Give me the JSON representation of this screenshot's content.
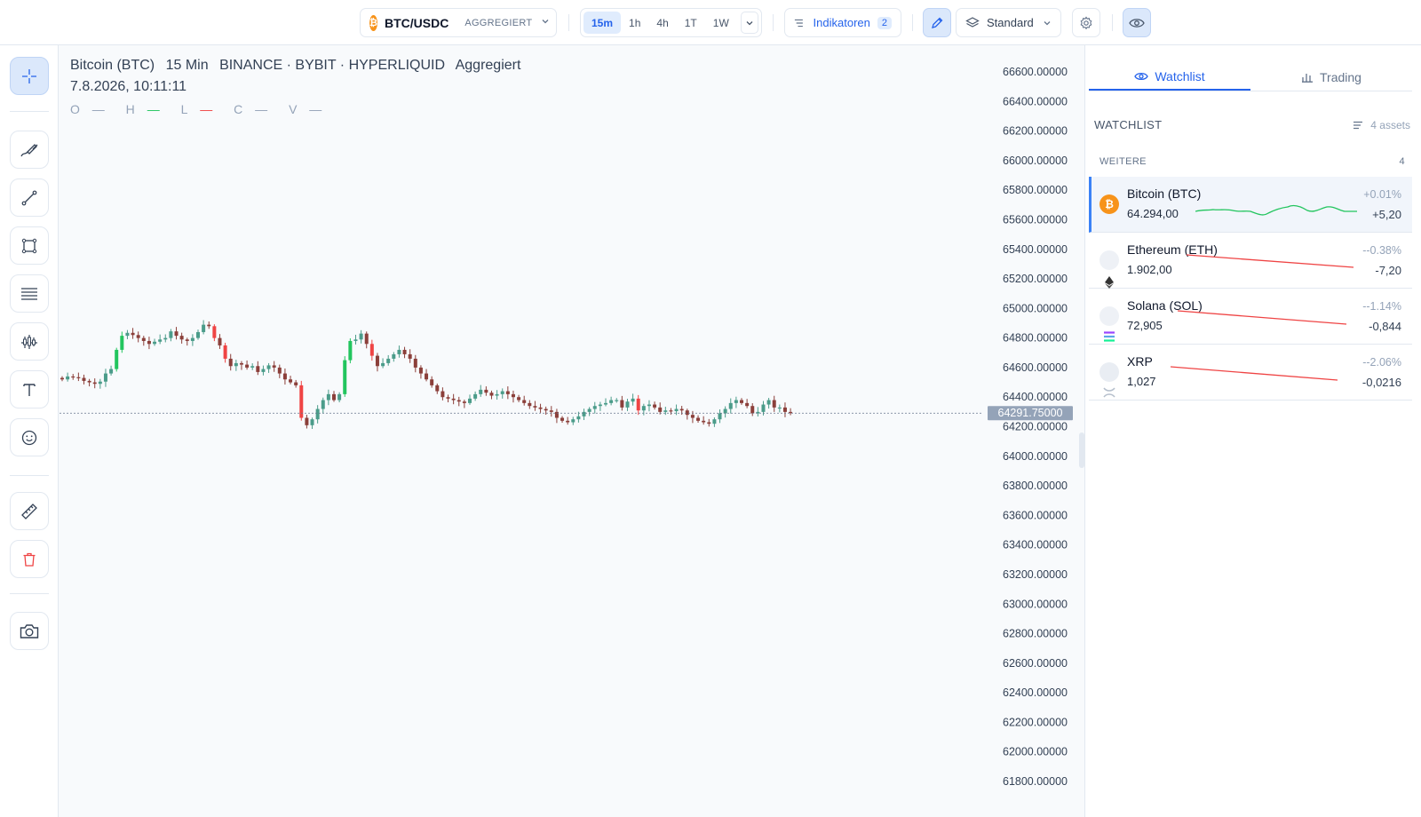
{
  "topbar": {
    "symbol": "BTC/USDC",
    "symbol_icon": "bitcoin-icon",
    "aggregation": "AGGREGIERT",
    "timeframes": [
      "15m",
      "1h",
      "4h",
      "1T",
      "1W"
    ],
    "active_timeframe": "15m",
    "indicators_label": "Indikatoren",
    "indicators_count": "2",
    "layout_label": "Standard"
  },
  "left_toolbar": {
    "tools": [
      "crosshair-icon",
      "brush-icon",
      "trend-line-icon",
      "rectangle-icon",
      "fib-levels-icon",
      "pattern-icon",
      "text-icon",
      "emoji-icon",
      "ruler-icon",
      "trash-icon",
      "camera-icon"
    ]
  },
  "chart": {
    "name": "Bitcoin (BTC)",
    "interval": "15 Min",
    "exchanges": "BINANCE · BYBIT · HYPERLIQUID",
    "mode": "Aggregiert",
    "timestamp": "7.8.2026, 10:11:11",
    "ohlcv": {
      "o": "O",
      "h": "H",
      "l": "L",
      "c": "C",
      "v": "V",
      "dash": "—"
    },
    "colors": {
      "up": "#22c55e",
      "down": "#ef4444",
      "up_muted": "#4b9c8a",
      "down_muted": "#8b3f3a"
    }
  },
  "chart_data": {
    "type": "candlestick",
    "y_ticks": [
      "66600.00000",
      "66400.00000",
      "66200.00000",
      "66000.00000",
      "65800.00000",
      "65600.00000",
      "65400.00000",
      "65200.00000",
      "65000.00000",
      "64800.00000",
      "64600.00000",
      "64400.00000",
      "64200.00000",
      "64000.00000",
      "63800.00000",
      "63600.00000",
      "63400.00000",
      "63200.00000",
      "63000.00000",
      "62800.00000",
      "62600.00000",
      "62400.00000",
      "62200.00000",
      "62000.00000",
      "61800.00000"
    ],
    "ylim": [
      61800,
      66600
    ],
    "last_price": 64291.75,
    "last_price_label": "64291.75000",
    "closes": [
      64520,
      64540,
      64535,
      64530,
      64510,
      64500,
      64490,
      64505,
      64560,
      64590,
      64720,
      64815,
      64835,
      64820,
      64800,
      64780,
      64760,
      64775,
      64790,
      64800,
      64845,
      64815,
      64790,
      64780,
      64800,
      64840,
      64890,
      64880,
      64800,
      64750,
      64660,
      64610,
      64630,
      64620,
      64600,
      64610,
      64570,
      64590,
      64615,
      64600,
      64560,
      64520,
      64500,
      64480,
      64260,
      64210,
      64250,
      64320,
      64380,
      64420,
      64380,
      64420,
      64650,
      64780,
      64790,
      64830,
      64760,
      64680,
      64610,
      64630,
      64660,
      64690,
      64720,
      64690,
      64660,
      64600,
      64560,
      64520,
      64480,
      64440,
      64400,
      64390,
      64380,
      64370,
      64360,
      64390,
      64420,
      64450,
      64430,
      64410,
      64420,
      64440,
      64420,
      64400,
      64380,
      64360,
      64340,
      64330,
      64320,
      64310,
      64300,
      64260,
      64240,
      64230,
      64250,
      64270,
      64300,
      64320,
      64340,
      64350,
      64360,
      64380,
      64380,
      64330,
      64370,
      64390,
      64310,
      64340,
      64350,
      64330,
      64300,
      64310,
      64305,
      64320,
      64310,
      64280,
      64260,
      64240,
      64230,
      64220,
      64250,
      64290,
      64320,
      64360,
      64380,
      64360,
      64340,
      64290,
      64300,
      64350,
      64380,
      64330,
      64330,
      64300,
      64291.75
    ],
    "candle_count": 125
  },
  "watchlist": {
    "tabs": [
      "Watchlist",
      "Trading"
    ],
    "active_tab": "Watchlist",
    "title": "WATCHLIST",
    "count_label": "4 assets",
    "group_name": "WEITERE",
    "group_count": "4",
    "assets": [
      {
        "name": "Bitcoin (BTC)",
        "price": "64.294,00",
        "pct": "+0.01%",
        "change": "+5,20",
        "icon": "bitcoin-icon",
        "trend": "up",
        "selected": true
      },
      {
        "name": "Ethereum (ETH)",
        "price": "1.902,00",
        "pct": "--0.38%",
        "change": "-7,20",
        "icon": "ethereum-icon",
        "trend": "down",
        "selected": false
      },
      {
        "name": "Solana (SOL)",
        "price": "72,905",
        "pct": "--1.14%",
        "change": "-0,844",
        "icon": "solana-icon",
        "trend": "down",
        "selected": false
      },
      {
        "name": "XRP",
        "price": "1,027",
        "pct": "--2.06%",
        "change": "-0,0216",
        "icon": "xrp-icon",
        "trend": "down",
        "selected": false
      }
    ]
  }
}
